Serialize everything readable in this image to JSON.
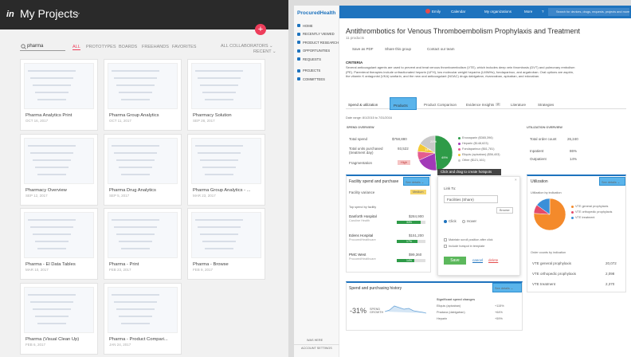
{
  "left": {
    "app_logo": "in",
    "title": "My Projects",
    "title_caret": "⌄",
    "new_button": "+",
    "search_value": "pharma",
    "tabs": [
      "ALL",
      "PROTOTYPES",
      "BOARDS",
      "FREEHANDS",
      "FAVORITES"
    ],
    "filter_collaborators": "ALL COLLABORATORS ⌄",
    "filter_sort": "RECENT ⌄",
    "cards": [
      {
        "title": "Pharma Analytics Print",
        "date": "OCT 16, 2017"
      },
      {
        "title": "Pharma Group Analytics",
        "date": "OCT 11, 2017"
      },
      {
        "title": "Pharmacy Solution",
        "date": "SEP 28, 2017"
      },
      {
        "title": "Pharmacy Overview",
        "date": "SEP 12, 2017"
      },
      {
        "title": "Pharma Drug Analytics",
        "date": "SEP 5, 2017"
      },
      {
        "title": "Pharma Group Analytics - ...",
        "date": "MAR 23, 2017"
      },
      {
        "title": "Pharma - El Data Tables",
        "date": "MAR 10, 2017"
      },
      {
        "title": "Pharma - Print",
        "date": "FEB 23, 2017"
      },
      {
        "title": "Pharma - Browse",
        "date": "FEB 9, 2017"
      },
      {
        "title": "Pharma (Visual Clean Up)",
        "date": "FEB 6, 2017"
      },
      {
        "title": "Pharma - Product Compari...",
        "date": "JAN 24, 2017"
      }
    ]
  },
  "nav": {
    "brand": "ProcuredHealth",
    "items": [
      "HOME",
      "RECENTLY VIEWED",
      "PRODUCT RESEARCH",
      "OPPORTUNITIES",
      "REQUESTS",
      "PROJECTS",
      "COMMITTEES"
    ],
    "footer1": "WAS HERE",
    "footer2": "ACCOUNT SETTINGS"
  },
  "topbar": {
    "user": "Emily",
    "calendar": "Calendar",
    "orgs": "My organizations",
    "more": "More",
    "help": "?",
    "search_placeholder": "Search for devices, drugs, requests, projects and more"
  },
  "page": {
    "title": "Antithrombotics for Venous Thromboembolism Prophylaxis and Treatment",
    "count": "11 products",
    "actions": [
      "Save as PDF",
      "Share this group",
      "Contact our team"
    ],
    "criteria_label": "CRITERIA",
    "criteria": "Several anticoagulant agents are used to prevent and treat venous thromboembolism (VTE), which includes deep vein thrombosis (DVT) and pulmonary embolism (PE). Parenteral therapies include unfractionated heparin (UFH), low molecular weight heparins (LMWHs), fondaparinux, and argatroban. Oral options are aspirin, the vitamin K antagonist (VKA) warfarin, and the new oral anticoagulant (NOAC) drugs dabigatran, rivaroxaban, apixaban, and edoxaban.",
    "tabs": [
      "Spend & utilization",
      "Products",
      "Product Comparison",
      "Evidence Insights",
      "Literature",
      "Strategies"
    ],
    "evidence_badge": "2",
    "date_range": "Date range: 8/1/2015 to 7/31/2016"
  },
  "spend": {
    "header": "SPEND OVERVIEW",
    "rows": [
      {
        "label": "Total spend",
        "value": "$758,880"
      },
      {
        "label": "Total units purchased (treatment day)",
        "value": "93,522"
      },
      {
        "label": "Fragmentation",
        "value": "High"
      }
    ],
    "legend": [
      {
        "label": "Enoxaparin ($365,396)",
        "color": "#2e9b48"
      },
      {
        "label": "Heparin ($148,623)",
        "color": "#a23ab8"
      },
      {
        "label": "Fondaparinux ($61,781)",
        "color": "#e45c8f"
      },
      {
        "label": "Eliquis (apixaban) ($56,403)",
        "color": "#f3c935"
      },
      {
        "label": "Other ($121,161)",
        "color": "#c9c9c9"
      }
    ],
    "pie_labels": [
      "49%",
      "14%",
      "20%"
    ]
  },
  "util": {
    "header": "UTILIZATION OVERVIEW",
    "rows": [
      {
        "label": "Total order count",
        "value": "26,240"
      },
      {
        "label": "Inpatient",
        "value": "86%"
      },
      {
        "label": "Outpatient",
        "value": "14%"
      }
    ]
  },
  "facility": {
    "title": "Facility spend and purchase",
    "see_details": "See details ⌄",
    "variance_label": "Facility variance",
    "variance_value": "Medium",
    "top_label": "Top spend by facility",
    "items": [
      {
        "name": "Danforth Hospital",
        "sub": "Caroline Health",
        "value": "$284,900",
        "fill": 0.82,
        "pct": "33%"
      },
      {
        "name": "Edens Hospital",
        "sub": "ProcuredHealthcare",
        "value": "$151,200",
        "fill": 0.72,
        "pct": "17%"
      },
      {
        "name": "PMC West",
        "sub": "ProcuredHealthcare",
        "value": "$99,360",
        "fill": 0.62,
        "pct": "14%"
      }
    ]
  },
  "hotspot": {
    "banner": "Click and drag to create hotspots",
    "link_to": "Link To:",
    "select_value": "Facilities (Share)",
    "browse": "Browse",
    "click": "Click",
    "hover": "Hover",
    "maintain": "Maintain scroll position after click",
    "include": "Include hotspot in template",
    "save": "Save",
    "cancel": "cancel",
    "delete": "delete",
    "close": "×"
  },
  "utilization": {
    "title": "Utilization",
    "see_details": "See details ⌄",
    "by_indication": "Utilization by indication",
    "legend": [
      {
        "label": "VTE general prophylaxis",
        "color": "#f48a2b"
      },
      {
        "label": "VTE orthopedic prophylaxis",
        "color": "#e44b6a"
      },
      {
        "label": "VTE treatment",
        "color": "#3a8fd8"
      }
    ],
    "pie_values": [
      0.76,
      0.09,
      0.15
    ],
    "order_header": "Order counts by indication",
    "orders": [
      {
        "label": "VTE general prophylaxis",
        "value": "20,072"
      },
      {
        "label": "VTE orthopedic prophylaxis",
        "value": "2,098"
      },
      {
        "label": "VTE treatment",
        "value": "2,370"
      }
    ]
  },
  "history": {
    "title": "Spend and purchasing history",
    "see_details": "See details ⌄",
    "change": "-31%",
    "change_label": "SPEND GROWTH",
    "sig_header": "Significant spend changes",
    "changes": [
      {
        "label": "Eliquis (apixaban)",
        "value": "+115%"
      },
      {
        "label": "Pradaxa (dabigatran)",
        "value": "+64%"
      },
      {
        "label": "Heparin",
        "value": "+59%"
      }
    ]
  },
  "colors": {
    "brand": "#1e73be",
    "highlight": "#5ab4eb",
    "save": "#5cb85c",
    "delete": "#e44b4b"
  }
}
